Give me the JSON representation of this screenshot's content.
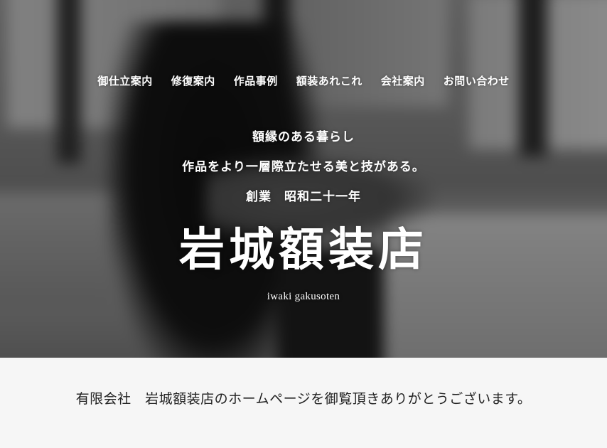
{
  "nav": {
    "items": [
      {
        "label": "御仕立案内"
      },
      {
        "label": "修復案内"
      },
      {
        "label": "作品事例"
      },
      {
        "label": "額装あれこれ"
      },
      {
        "label": "会社案内"
      },
      {
        "label": "お問い合わせ"
      }
    ]
  },
  "hero": {
    "tagline_1": "額縁のある暮らし",
    "tagline_2": "作品をより一層際立たせる美と技がある。",
    "tagline_3": "創業　昭和二十一年",
    "logo": "岩城額装店",
    "logo_sub": "iwaki gakusoten"
  },
  "main": {
    "welcome": "有限会社　岩城額装店のホームページを御覧頂きありがとうございます。"
  }
}
